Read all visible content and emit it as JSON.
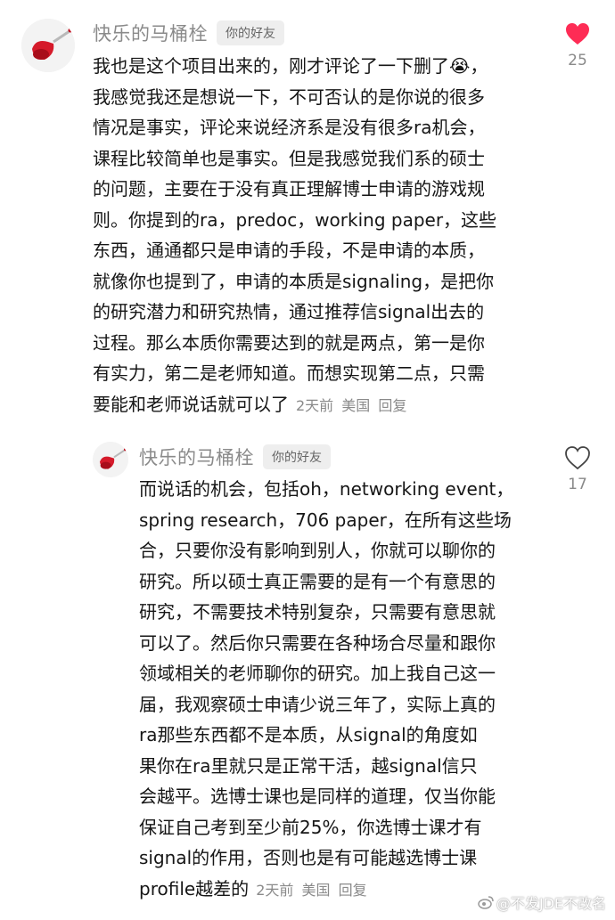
{
  "comments": [
    {
      "username": "快乐的马桶栓",
      "badge": "你的好友",
      "lines": [
        "我也是这个项目出来的，刚才评论了一下删了😭，",
        "我感觉我还是想说一下，不可否认的是你说的很多",
        "情况是事实，评论来说经济系是没有很多ra机会，",
        "课程比较简单也是事实。但是我感觉我们系的硕士",
        "的问题，主要在于没有真正理解博士申请的游戏规",
        "则。你提到的ra，predoc，working paper，这些",
        "东西，通通都只是申请的手段，不是申请的本质，",
        "就像你也提到了，申请的本质是signaling，是把你",
        "的研究潜力和研究热情，通过推荐信signal出去的",
        "过程。那么本质你需要达到的就是两点，第一是你",
        "有实力，第二是老师知道。而想实现第二点，只需",
        "要能和老师说话就可以了"
      ],
      "time": "2天前",
      "location": "美国",
      "reply_label": "回复",
      "likes": "25",
      "liked": true
    },
    {
      "username": "快乐的马桶栓",
      "badge": "你的好友",
      "lines": [
        "而说话的机会，包括oh，networking event，",
        "spring research，706 paper，在所有这些场",
        "合，只要你没有影响到别人，你就可以聊你的",
        "研究。所以硕士真正需要的是有一个有意思的",
        "研究，不需要技术特别复杂，只需要有意思就",
        "可以了。然后你只需要在各种场合尽量和跟你",
        "领域相关的老师聊你的研究。加上我自己这一",
        "届，我观察硕士申请少说三年了，实际上真的",
        "ra那些东西都不是本质，从signal的角度如",
        "果你在ra里就只是正常干活，越signal信只",
        "会越平。选博士课也是同样的道理，仅当你能",
        "保证自己考到至少前25%，你选博士课才有",
        "signal的作用，否则也是有可能越选博士课",
        "profile越差的"
      ],
      "time": "2天前",
      "location": "美国",
      "reply_label": "回复",
      "likes": "17",
      "liked": false
    }
  ],
  "watermark": "@不发JDE不改名",
  "colors": {
    "like_active": "#fe2c55",
    "meta": "#8a8a8a",
    "text": "#161616"
  },
  "icons": {
    "liked": "heart-filled-icon",
    "unliked": "heart-outline-icon",
    "watermark": "weibo-icon"
  }
}
